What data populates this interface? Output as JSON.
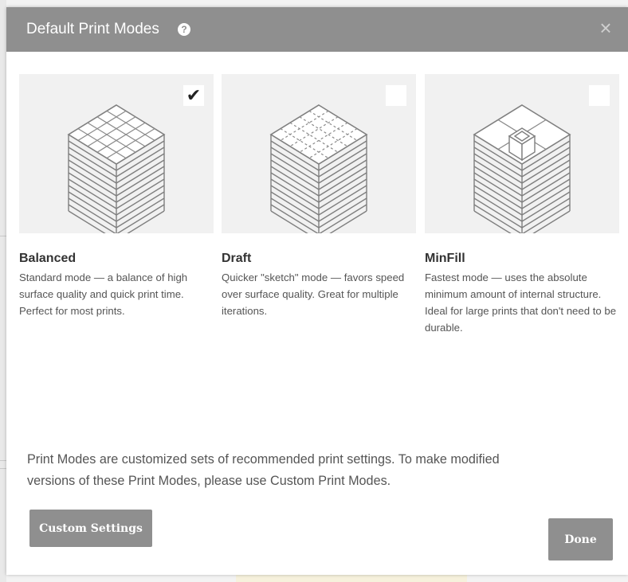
{
  "dialog": {
    "title": "Default Print Modes",
    "help_icon": "question-circle-icon",
    "close_icon": "close-icon"
  },
  "modes": [
    {
      "name": "Balanced",
      "description": "Standard mode — a balance of high surface quality and quick print time. Perfect for most prints.",
      "selected": true,
      "icon": "balanced-layers-grid-icon"
    },
    {
      "name": "Draft",
      "description": "Quicker \"sketch\" mode — favors speed over surface quality. Great for multiple iterations.",
      "selected": false,
      "icon": "draft-layers-dashed-icon"
    },
    {
      "name": "MinFill",
      "description": "Fastest mode — uses the absolute minimum amount of internal structure. Ideal for large prints that don't need to be durable.",
      "selected": false,
      "icon": "minfill-layers-column-icon"
    }
  ],
  "footer": {
    "text": "Print Modes are customized sets of recommended print settings. To make modified versions of these Print Modes, please use Custom Print Modes."
  },
  "buttons": {
    "custom_settings": "Custom Settings",
    "done": "Done"
  },
  "colors": {
    "header": "#8f8f8f",
    "button": "#8f8f8f",
    "card_bg": "#f1f1f1"
  }
}
